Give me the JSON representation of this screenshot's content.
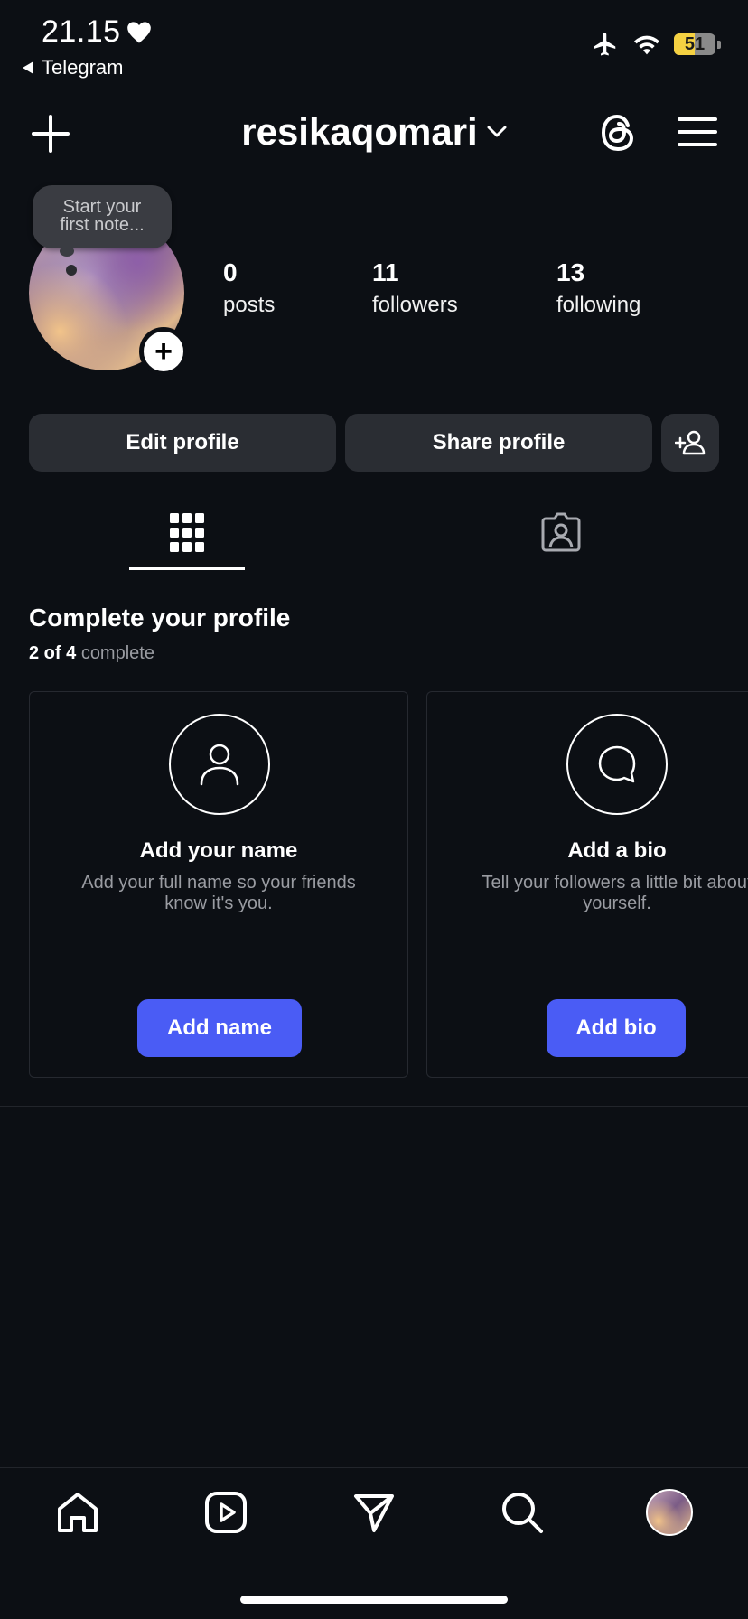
{
  "status_bar": {
    "time": "21.15",
    "back_app": "Telegram",
    "battery": "51"
  },
  "header": {
    "username": "resikaqomari"
  },
  "profile": {
    "note_placeholder": "Start your first note...",
    "stats": [
      {
        "value": "0",
        "label": "posts"
      },
      {
        "value": "11",
        "label": "followers"
      },
      {
        "value": "13",
        "label": "following"
      }
    ]
  },
  "actions": {
    "edit_profile": "Edit profile",
    "share_profile": "Share profile"
  },
  "complete_profile": {
    "title": "Complete your profile",
    "progress_done": "2 of 4",
    "progress_suffix": "complete",
    "cards": [
      {
        "title": "Add your name",
        "description": "Add your full name so your friends know it's you.",
        "button": "Add name"
      },
      {
        "title": "Add a bio",
        "description": "Tell your followers a little bit about yourself.",
        "button": "Add bio"
      }
    ]
  },
  "nav": [
    "home-icon",
    "reels-icon",
    "direct-message-icon",
    "search-icon",
    "profile-avatar"
  ],
  "colors": {
    "background": "#0c0f14",
    "button_bg": "#2a2d33",
    "accent": "#4a5cf5",
    "battery": "#f5d142"
  }
}
